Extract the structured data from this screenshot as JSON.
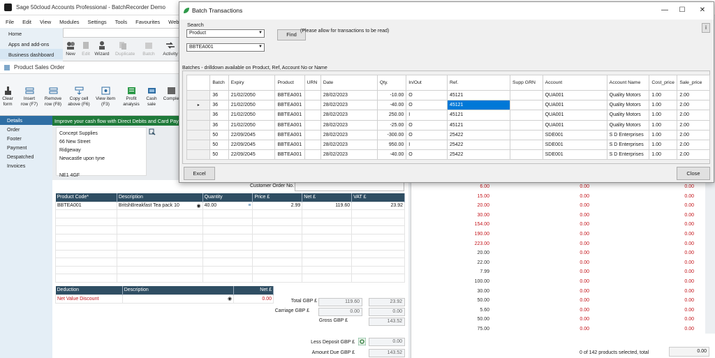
{
  "main_window": {
    "title": "Sage 50cloud Accounts Professional - BatchRecorder Demo",
    "menu": [
      "File",
      "Edit",
      "View",
      "Modules",
      "Settings",
      "Tools",
      "Favourites",
      "WebLi"
    ],
    "nav": [
      "Home",
      "Apps and add-ons",
      "Business dashboard"
    ],
    "toolbar": [
      {
        "label": "New",
        "enabled": true
      },
      {
        "label": "Edit",
        "enabled": false
      },
      {
        "label": "Wizard",
        "enabled": true
      },
      {
        "label": "Duplicate",
        "enabled": false
      },
      {
        "label": "Batch",
        "enabled": false
      },
      {
        "label": "Activity",
        "enabled": true
      }
    ]
  },
  "sales_order": {
    "title": "Product Sales Order",
    "toolbar": [
      {
        "line1": "Clear",
        "line2": "form"
      },
      {
        "line1": "Insert",
        "line2": "row (F7)"
      },
      {
        "line1": "Remove",
        "line2": "row (F8)"
      },
      {
        "line1": "Copy cell",
        "line2": "above (F6)"
      },
      {
        "line1": "View item",
        "line2": "(F3)"
      },
      {
        "line1": "Profit",
        "line2": "analysis"
      },
      {
        "line1": "Cash",
        "line2": "sale"
      },
      {
        "line1": "Comple",
        "line2": ""
      }
    ],
    "tabs": [
      "Details",
      "Order",
      "Footer",
      "Payment",
      "Despatched",
      "Invoices"
    ],
    "active_tab": "Details",
    "promo": "Improve your cash flow with Direct Debits and Card Paym",
    "address": [
      "Concept Supplies",
      "66 New Street",
      "Ridgeway",
      "Newcastle upon tyne",
      "",
      "NE1 4GF"
    ],
    "customer_order_label": "Customer Order No.",
    "lines_headers": [
      "Product Code*",
      "Description",
      "Quantity",
      "Price £",
      "Net £",
      "VAT £"
    ],
    "line": {
      "code": "BBTEA001",
      "description": "BritshBreakfast  Tea pack 10",
      "quantity": "40.00",
      "price": "2.99",
      "net": "119.60",
      "vat": "23.92"
    },
    "deduction_headers": [
      "Deduction",
      "Description",
      "Net £"
    ],
    "deduction": {
      "name": "Net Value Discount",
      "net": "0.00"
    },
    "totals": {
      "total_label": "Total GBP £",
      "total_net": "119.60",
      "total_vat": "23.92",
      "carriage_label": "Carriage GBP £",
      "carriage_net": "0.00",
      "carriage_vat": "0.00",
      "gross_label": "Gross GBP £",
      "gross": "143.52",
      "deposit_label": "Less Deposit GBP £",
      "deposit": "0.00",
      "amount_due_label": "Amount Due GBP £",
      "amount_due": "143.52"
    }
  },
  "right_list": {
    "rows": [
      [
        "6.00",
        "0.00",
        "0.00",
        true
      ],
      [
        "15.00",
        "0.00",
        "0.00",
        true
      ],
      [
        "20.00",
        "0.00",
        "0.00",
        true
      ],
      [
        "30.00",
        "0.00",
        "0.00",
        true
      ],
      [
        "154.00",
        "0.00",
        "0.00",
        true
      ],
      [
        "190.00",
        "0.00",
        "0.00",
        true
      ],
      [
        "223.00",
        "0.00",
        "0.00",
        true
      ],
      [
        "20.00",
        "0.00",
        "0.00",
        false
      ],
      [
        "22.00",
        "0.00",
        "0.00",
        false
      ],
      [
        "7.99",
        "0.00",
        "0.00",
        false
      ],
      [
        "100.00",
        "0.00",
        "0.00",
        false
      ],
      [
        "30.00",
        "0.00",
        "0.00",
        false
      ],
      [
        "50.00",
        "0.00",
        "0.00",
        false
      ],
      [
        "5.60",
        "0.00",
        "0.00",
        false
      ],
      [
        "50.00",
        "0.00",
        "0.00",
        false
      ],
      [
        "75.00",
        "0.00",
        "0.00",
        false
      ]
    ],
    "footer": "0 of 142 products selected, total",
    "footer_total": "0.00"
  },
  "dialog": {
    "title": "Batch Transactions",
    "search_label": "Search",
    "search_field": "Product",
    "search_value": "BBTEA001",
    "find_label": "Find",
    "note": "(Please allow for transactions to be read)",
    "info_label": "i",
    "batches_label": "Batches - drilldown available on Product, Ref, Account No or Name",
    "columns": [
      "Batch",
      "Expiry",
      "Product",
      "URN",
      "Date",
      "Qty.",
      "In/Out",
      "Ref.",
      "Supp GRN",
      "Account",
      "Account Name",
      "Cost_price",
      "Sale_price"
    ],
    "rows": [
      [
        "36",
        "21/02/2050",
        "BBTEA001",
        "",
        "28/02/2023",
        "-10.00",
        "O",
        "45121",
        "",
        "QUA001",
        "Quality Motors",
        "1.00",
        "2.00"
      ],
      [
        "36",
        "21/02/2050",
        "BBTEA001",
        "",
        "28/02/2023",
        "-40.00",
        "O",
        "45121",
        "",
        "QUA001",
        "Quality Motors",
        "1.00",
        "2.00"
      ],
      [
        "36",
        "21/02/2050",
        "BBTEA001",
        "",
        "28/02/2023",
        "250.00",
        "I",
        "45121",
        "",
        "QUA001",
        "Quality Motors",
        "1.00",
        "2.00"
      ],
      [
        "36",
        "21/02/2050",
        "BBTEA001",
        "",
        "28/02/2023",
        "-25.00",
        "O",
        "45121",
        "",
        "QUA001",
        "Quality Motors",
        "1.00",
        "2.00"
      ],
      [
        "50",
        "22/09/2045",
        "BBTEA001",
        "",
        "28/02/2023",
        "-300.00",
        "O",
        "25422",
        "",
        "SDE001",
        "S D Enterprises",
        "1.00",
        "2.00"
      ],
      [
        "50",
        "22/09/2045",
        "BBTEA001",
        "",
        "28/02/2023",
        "950.00",
        "I",
        "25422",
        "",
        "SDE001",
        "S D Enterprises",
        "1.00",
        "2.00"
      ],
      [
        "50",
        "22/09/2045",
        "BBTEA001",
        "",
        "28/02/2023",
        "-40.00",
        "O",
        "25422",
        "",
        "SDE001",
        "S D Enterprises",
        "1.00",
        "2.00"
      ]
    ],
    "current_row": 1,
    "selected_column": 7,
    "excel_label": "Excel",
    "close_label": "Close",
    "colors": {
      "selection": "#0078d7"
    }
  }
}
